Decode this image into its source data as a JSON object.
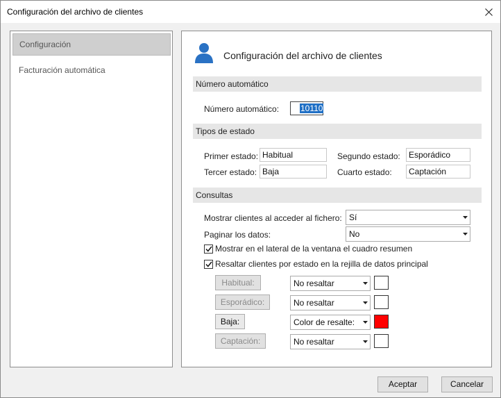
{
  "window": {
    "title": "Configuración del archivo de clientes"
  },
  "sidebar": {
    "items": [
      {
        "label": "Configuración",
        "active": true
      },
      {
        "label": "Facturación automática",
        "active": false
      }
    ]
  },
  "main": {
    "header_title": "Configuración del archivo de clientes",
    "numero_section": {
      "title": "Número automático",
      "field_label": "Número automático:",
      "field_value": "10110"
    },
    "tipos_section": {
      "title": "Tipos de estado",
      "primer_label": "Primer estado:",
      "primer_value": "Habitual",
      "segundo_label": "Segundo estado:",
      "segundo_value": "Esporádico",
      "tercer_label": "Tercer estado:",
      "tercer_value": "Baja",
      "cuarto_label": "Cuarto estado:",
      "cuarto_value": "Captación"
    },
    "consultas_section": {
      "title": "Consultas",
      "mostrar_label": "Mostrar clientes al acceder al fichero:",
      "mostrar_value": "Sí",
      "paginar_label": "Paginar los datos:",
      "paginar_value": "No",
      "check_lateral_label": "Mostrar en el lateral de la ventana el cuadro resumen",
      "check_lateral_checked": true,
      "check_resaltar_label": "Resaltar clientes por estado en la rejilla de datos principal",
      "check_resaltar_checked": true
    },
    "states": [
      {
        "button": "Habitual:",
        "enabled": false,
        "option": "No resaltar",
        "color": "#ffffff"
      },
      {
        "button": "Esporádico:",
        "enabled": false,
        "option": "No resaltar",
        "color": "#ffffff"
      },
      {
        "button": "Baja:",
        "enabled": true,
        "option": "Color de resalte:",
        "color": "#ff0000"
      },
      {
        "button": "Captación:",
        "enabled": false,
        "option": "No resaltar",
        "color": "#ffffff"
      }
    ]
  },
  "footer": {
    "accept_label": "Aceptar",
    "cancel_label": "Cancelar"
  }
}
